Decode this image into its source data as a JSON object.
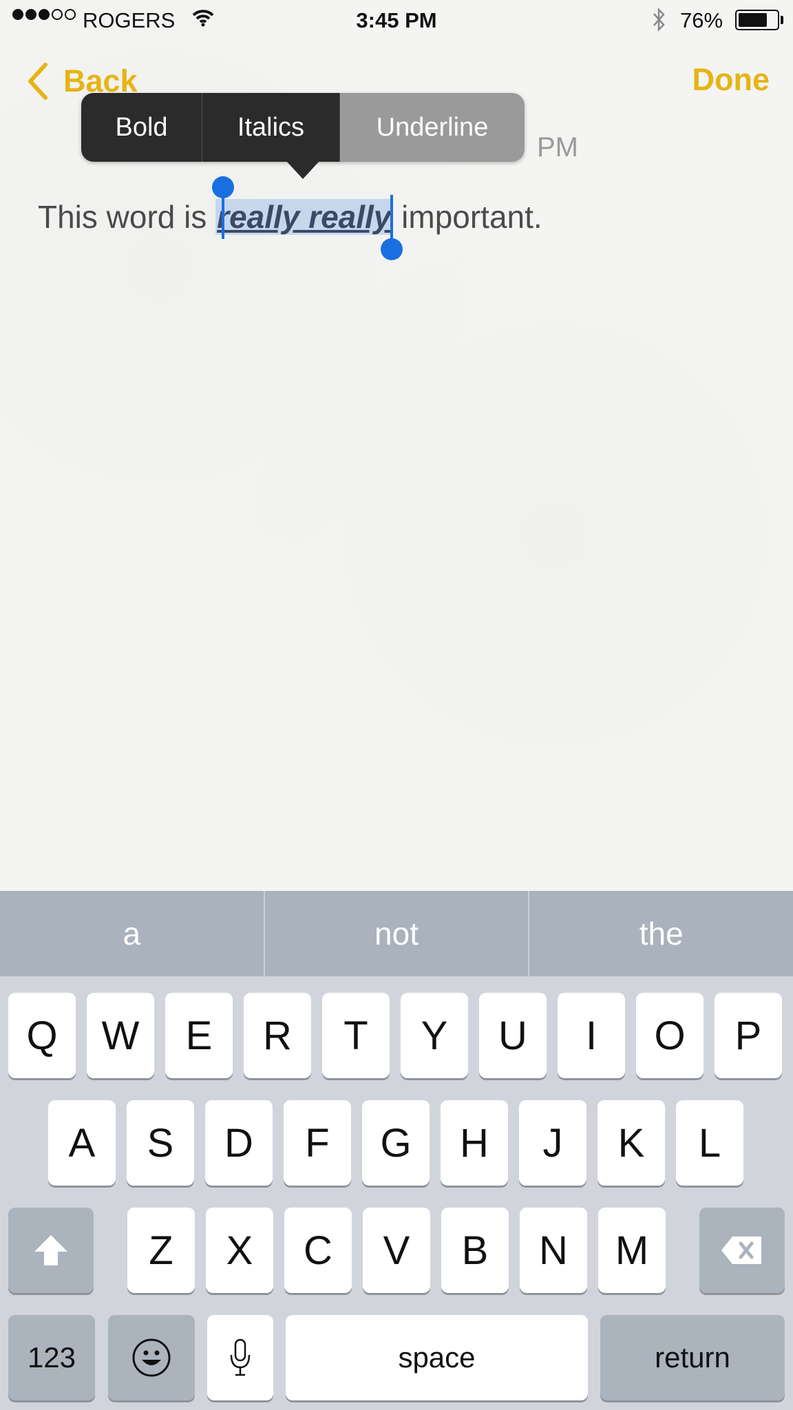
{
  "status_bar": {
    "carrier": "ROGERS",
    "time": "3:45 PM",
    "battery_pct": "76%",
    "battery_level": 0.76,
    "signal_bars_filled": 3,
    "signal_bars_total": 5
  },
  "nav": {
    "back_label": "Back",
    "done_label": "Done"
  },
  "accent_color": "#e6b414",
  "edit_menu": {
    "items": [
      {
        "label": "Bold"
      },
      {
        "label": "Italics"
      },
      {
        "label": "Underline",
        "highlighted": true
      }
    ]
  },
  "note": {
    "date_visible_fragment": "PM",
    "text_before": "This word is ",
    "selected_text": "really really",
    "text_after": " important."
  },
  "keyboard": {
    "predictions": [
      "a",
      "not",
      "the"
    ],
    "row1": [
      "Q",
      "W",
      "E",
      "R",
      "T",
      "Y",
      "U",
      "I",
      "O",
      "P"
    ],
    "row2": [
      "A",
      "S",
      "D",
      "F",
      "G",
      "H",
      "J",
      "K",
      "L"
    ],
    "row3": [
      "Z",
      "X",
      "C",
      "V",
      "B",
      "N",
      "M"
    ],
    "numbers_label": "123",
    "space_label": "space",
    "return_label": "return"
  },
  "icons": [
    "wifi-icon",
    "bluetooth-icon",
    "battery-icon",
    "back-chevron-icon",
    "shift-icon",
    "delete-icon",
    "emoji-icon",
    "microphone-icon"
  ]
}
